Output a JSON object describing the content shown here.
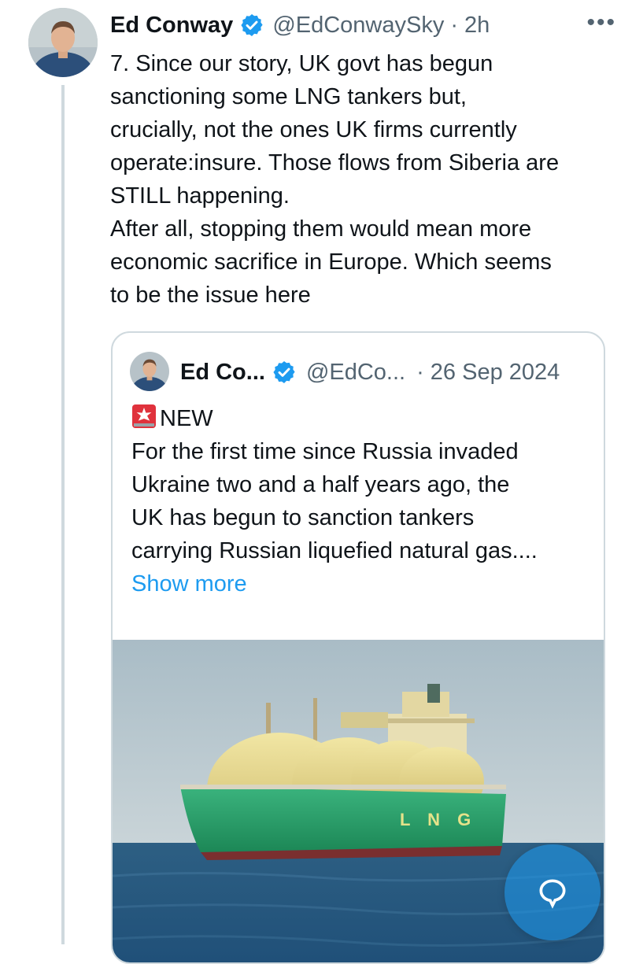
{
  "tweet": {
    "author_name": "Ed Conway",
    "handle": "@EdConwaySky",
    "separator": "·",
    "time": "2h",
    "more_label": "•••",
    "text_lines": [
      "7. Since our story, UK govt has begun",
      "sanctioning some LNG tankers but,",
      "crucially, not the ones UK firms currently",
      "operate:insure. Those flows from Siberia are",
      "STILL happening.",
      "After all, stopping them would mean more",
      "economic sacrifice in Europe. Which seems",
      "to be the issue here"
    ]
  },
  "quote": {
    "author_name": "Ed Co...",
    "handle": "@EdCo...",
    "separator": "·",
    "date": "26 Sep 2024",
    "badge_text": "NEW",
    "text_lines": [
      "For the first time since Russia invaded",
      "Ukraine two and a half years ago, the",
      "UK has begun to sanction tankers",
      "carrying Russian liquefied natural gas...."
    ],
    "show_more": "Show more",
    "hull_lettering": "L N G"
  },
  "colors": {
    "link": "#1d9bf0",
    "secondary_text": "#536471",
    "verified": "#1d9bf0",
    "border": "#cfd9de"
  },
  "icons": {
    "verified": "verified-badge-icon",
    "more": "more-horizontal-icon",
    "siren": "rotating-light-icon",
    "compose": "reply-bubble-icon"
  }
}
